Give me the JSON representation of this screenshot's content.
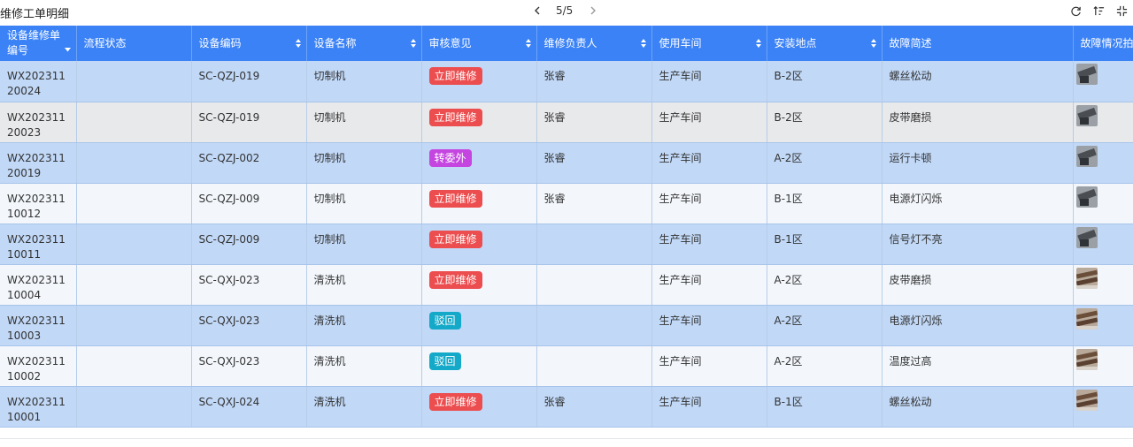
{
  "title": "维修工单明细",
  "pager": {
    "text": "5/5"
  },
  "colors": {
    "header_bg": "#3b82f6",
    "row_blue": "#c1d8f7",
    "row_light": "#f3f7fc",
    "badge_red": "#ec4d4f",
    "badge_purple": "#c545e0",
    "badge_teal": "#14a9c8"
  },
  "columns": [
    {
      "label": "设备维修单编号"
    },
    {
      "label": "流程状态"
    },
    {
      "label": "设备编码"
    },
    {
      "label": "设备名称"
    },
    {
      "label": "审核意见"
    },
    {
      "label": "维修负责人"
    },
    {
      "label": "使用车间"
    },
    {
      "label": "安装地点"
    },
    {
      "label": "故障简述"
    },
    {
      "label": "故障情况拍"
    }
  ],
  "rows": [
    {
      "id": "WX20231120024",
      "status": "",
      "code": "SC-QZJ-019",
      "name": "切制机",
      "opinion": "立即维修",
      "opinion_color": "red",
      "owner": "张睿",
      "workshop": "生产车间",
      "location": "B-2区",
      "fault": "螺丝松动",
      "photo": "machine-dark"
    },
    {
      "id": "WX20231120023",
      "status": "",
      "code": "SC-QZJ-019",
      "name": "切制机",
      "opinion": "立即维修",
      "opinion_color": "red",
      "owner": "张睿",
      "workshop": "生产车间",
      "location": "B-2区",
      "fault": "皮带磨损",
      "photo": "machine-dark"
    },
    {
      "id": "WX20231120019",
      "status": "",
      "code": "SC-QZJ-002",
      "name": "切制机",
      "opinion": "转委外",
      "opinion_color": "purple",
      "owner": "张睿",
      "workshop": "生产车间",
      "location": "A-2区",
      "fault": "运行卡顿",
      "photo": "machine-dark"
    },
    {
      "id": "WX20231110012",
      "status": "",
      "code": "SC-QZJ-009",
      "name": "切制机",
      "opinion": "立即维修",
      "opinion_color": "red",
      "owner": "张睿",
      "workshop": "生产车间",
      "location": "B-1区",
      "fault": "电源灯闪烁",
      "photo": "machine-dark"
    },
    {
      "id": "WX20231110011",
      "status": "",
      "code": "SC-QZJ-009",
      "name": "切制机",
      "opinion": "立即维修",
      "opinion_color": "red",
      "owner": "",
      "workshop": "生产车间",
      "location": "B-1区",
      "fault": "信号灯不亮",
      "photo": "machine-dark"
    },
    {
      "id": "WX20231110004",
      "status": "",
      "code": "SC-QXJ-023",
      "name": "清洗机",
      "opinion": "立即维修",
      "opinion_color": "red",
      "owner": "",
      "workshop": "生产车间",
      "location": "A-2区",
      "fault": "皮带磨损",
      "photo": "machine-brown"
    },
    {
      "id": "WX20231110003",
      "status": "",
      "code": "SC-QXJ-023",
      "name": "清洗机",
      "opinion": "驳回",
      "opinion_color": "teal",
      "owner": "",
      "workshop": "生产车间",
      "location": "A-2区",
      "fault": "电源灯闪烁",
      "photo": "machine-brown"
    },
    {
      "id": "WX20231110002",
      "status": "",
      "code": "SC-QXJ-023",
      "name": "清洗机",
      "opinion": "驳回",
      "opinion_color": "teal",
      "owner": "",
      "workshop": "生产车间",
      "location": "A-2区",
      "fault": "温度过高",
      "photo": "machine-brown"
    },
    {
      "id": "WX20231110001",
      "status": "",
      "code": "SC-QXJ-024",
      "name": "清洗机",
      "opinion": "立即维修",
      "opinion_color": "red",
      "owner": "张睿",
      "workshop": "生产车间",
      "location": "B-1区",
      "fault": "螺丝松动",
      "photo": "machine-brown"
    }
  ]
}
